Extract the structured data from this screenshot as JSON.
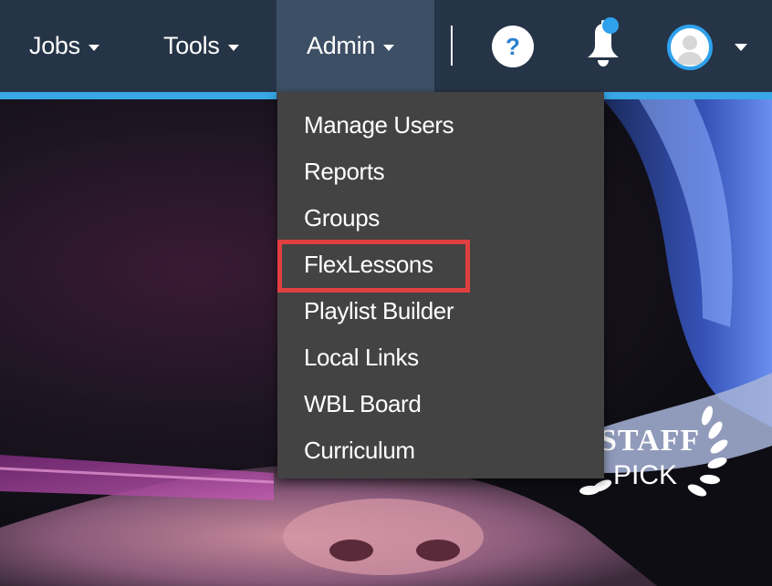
{
  "navbar": {
    "items": [
      {
        "label": "Jobs"
      },
      {
        "label": "Tools"
      },
      {
        "label": "Admin"
      }
    ],
    "help_icon": "?",
    "bell_icon": "bell-icon",
    "avatar_icon": "user-avatar-icon",
    "accent_color": "#37a7e6"
  },
  "admin_menu": {
    "items": [
      {
        "label": "Manage Users"
      },
      {
        "label": "Reports"
      },
      {
        "label": "Groups"
      },
      {
        "label": "FlexLessons"
      },
      {
        "label": "Playlist Builder"
      },
      {
        "label": "Local Links"
      },
      {
        "label": "WBL Board"
      },
      {
        "label": "Curriculum"
      }
    ],
    "highlighted_item": "FlexLessons",
    "highlight_color": "#e0403f"
  },
  "badge": {
    "line1": "STAFF",
    "line2": "PICK"
  }
}
